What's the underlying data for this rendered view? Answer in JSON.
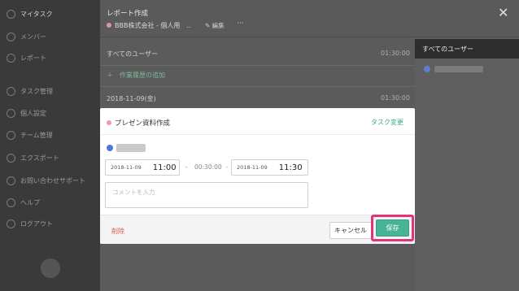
{
  "sidebar": {
    "items": [
      {
        "label": "マイタスク",
        "icon": "home-icon"
      },
      {
        "label": "メンバー",
        "icon": "user-icon"
      },
      {
        "label": "レポート",
        "icon": "clock-icon"
      },
      {
        "label": "タスク管理",
        "icon": "gear-icon"
      },
      {
        "label": "個人設定",
        "icon": "person-icon"
      },
      {
        "label": "チーム管理",
        "icon": "team-icon"
      },
      {
        "label": "エクスポート",
        "icon": "download-icon"
      },
      {
        "label": "お問い合わせサポート",
        "icon": "chat-icon"
      },
      {
        "label": "ヘルプ",
        "icon": "help-icon"
      },
      {
        "label": "ログアウト",
        "icon": "logout-icon"
      }
    ]
  },
  "header": {
    "title": "レポート作成",
    "company": "BBB株式会社 - 個人用　..",
    "edit_label": "✎ 編集",
    "more_label": "···",
    "close_label": "✕"
  },
  "report": {
    "all_users_label": "すべてのユーザー",
    "all_users_time": "01:30:00",
    "add_history_label": "＋　作業履歴の追加",
    "date_label": "2018-11-09(金)",
    "date_time": "01:30:00"
  },
  "right_panel": {
    "header": "すべてのユーザー"
  },
  "modal": {
    "task_title": "プレゼン資料作成",
    "change_task_label": "タスク変更",
    "start_date": "2018-11-09",
    "start_time": "11:00",
    "duration": "00:30:00",
    "end_date": "2018-11-09",
    "end_time": "11:30",
    "dash": "–",
    "comment_placeholder": "コメントを入力",
    "delete_label": "削除",
    "cancel_label": "キャンセル",
    "save_label": "保存"
  },
  "colors": {
    "accent": "#48b395",
    "highlight": "#e8317d",
    "delete": "#d55c5c",
    "task_dot": "#ec9ab2"
  }
}
